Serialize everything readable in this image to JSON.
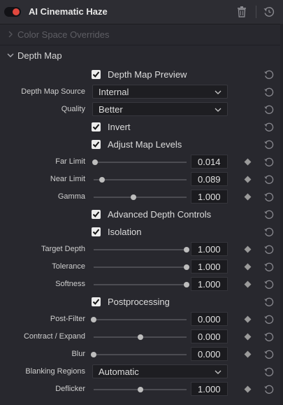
{
  "header": {
    "title": "AI Cinematic Haze",
    "enabled": true
  },
  "sections": {
    "color_space": {
      "label": "Color Space Overrides"
    },
    "depth_map": {
      "label": "Depth Map"
    }
  },
  "controls": {
    "depth_map_preview": {
      "label": "Depth Map Preview",
      "checked": true
    },
    "depth_map_source": {
      "label": "Depth Map Source",
      "value": "Internal"
    },
    "quality": {
      "label": "Quality",
      "value": "Better"
    },
    "invert": {
      "label": "Invert",
      "checked": true
    },
    "adjust_map_levels": {
      "label": "Adjust Map Levels",
      "checked": true
    },
    "far_limit": {
      "label": "Far Limit",
      "value": "0.014",
      "fraction": 0.014
    },
    "near_limit": {
      "label": "Near Limit",
      "value": "0.089",
      "fraction": 0.089
    },
    "gamma": {
      "label": "Gamma",
      "value": "1.000",
      "fraction": 0.43
    },
    "advanced_depth_controls": {
      "label": "Advanced Depth Controls",
      "checked": true
    },
    "isolation": {
      "label": "Isolation",
      "checked": true
    },
    "target_depth": {
      "label": "Target Depth",
      "value": "1.000",
      "fraction": 1.0
    },
    "tolerance": {
      "label": "Tolerance",
      "value": "1.000",
      "fraction": 1.0
    },
    "softness": {
      "label": "Softness",
      "value": "1.000",
      "fraction": 1.0
    },
    "postprocessing": {
      "label": "Postprocessing",
      "checked": true
    },
    "post_filter": {
      "label": "Post-Filter",
      "value": "0.000",
      "fraction": 0.0
    },
    "contract_expand": {
      "label": "Contract / Expand",
      "value": "0.000",
      "fraction": 0.5
    },
    "blur": {
      "label": "Blur",
      "value": "0.000",
      "fraction": 0.0
    },
    "blanking_regions": {
      "label": "Blanking Regions",
      "value": "Automatic"
    },
    "deflicker": {
      "label": "Deflicker",
      "value": "1.000",
      "fraction": 0.5
    }
  },
  "icons": {
    "trash": "trash-icon",
    "reset": "reset-icon",
    "keyframe": "keyframe-diamond-icon",
    "chevron_right": "chevron-right-icon",
    "chevron_down": "chevron-down-icon",
    "check": "check-icon"
  },
  "colors": {
    "accent_toggle": "#e0483e",
    "panel_bg": "#28282e",
    "field_bg": "#1b1b1f"
  }
}
